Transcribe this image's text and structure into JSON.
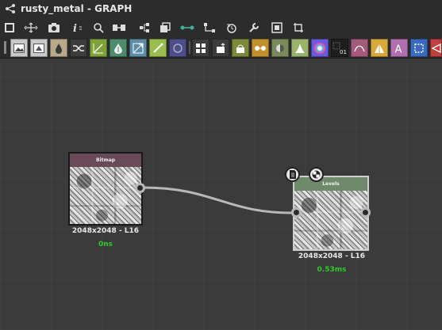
{
  "window": {
    "title": "rusty_metal - GRAPH"
  },
  "toolbar": {
    "tools": [
      "frame-icon",
      "fit-view-icon",
      "camera-icon",
      "info-icon",
      "search-icon",
      "align-icon",
      "hierarchy-icon",
      "layers-icon",
      "connect-icon",
      "route-icon",
      "history-icon",
      "wrench-icon",
      "export-icon",
      "crop-icon"
    ]
  },
  "node_palette": {
    "buttons": [
      {
        "name": "bitmap-node-button",
        "color": "#c9c9c9"
      },
      {
        "name": "svg-node-button",
        "color": "#c9c9c9"
      },
      {
        "name": "color-node-button",
        "color": "#b7a98a"
      },
      {
        "name": "switch-node-button",
        "color": "#3c3c3c"
      },
      {
        "name": "curve-node-button",
        "color": "#7fa13a"
      },
      {
        "name": "gradient-node-button",
        "color": "#4c8c6b"
      },
      {
        "name": "transform-node-button",
        "color": "#5b8ca8"
      },
      {
        "name": "warp-node-button",
        "color": "#9bbd4d"
      },
      {
        "name": "blend-node-button",
        "color": "#4d4d8c"
      },
      {
        "name": "grid-node-button",
        "color": "#3c3c3c"
      },
      {
        "name": "input-node-button",
        "color": "#3c3c3c"
      },
      {
        "name": "fx-map-node-button",
        "color": "#7a8a3a"
      },
      {
        "name": "pixel-processor-node-button",
        "color": "#c0902a"
      },
      {
        "name": "normal-node-button",
        "color": "#7a8a5a"
      },
      {
        "name": "histogram-node-button",
        "color": "#9ab26a"
      },
      {
        "name": "hsl-node-button",
        "color": "#6a5ae0"
      },
      {
        "name": "output-node-button",
        "color": "#1e1e1e"
      },
      {
        "name": "spline-node-button",
        "color": "#a65a7a"
      },
      {
        "name": "levels-node-button",
        "color": "#d8a83a"
      },
      {
        "name": "text-node-button",
        "color": "#b070b0"
      },
      {
        "name": "selection-node-button",
        "color": "#3a6ac0"
      },
      {
        "name": "sharpen-node-button",
        "color": "#c04040"
      }
    ],
    "output_label": "01",
    "text_label": "A"
  },
  "nodes": [
    {
      "name": "Bitmap",
      "resolution": "2048x2048 - L16",
      "time": "0ns",
      "header_color": "#6a4a58"
    },
    {
      "name": "Levels",
      "resolution": "2048x2048 - L16",
      "time": "0.53ms",
      "header_color": "#6f8a6a"
    }
  ],
  "colors": {
    "time_text": "#2ecc2e",
    "wire": "#b8b8b8"
  }
}
